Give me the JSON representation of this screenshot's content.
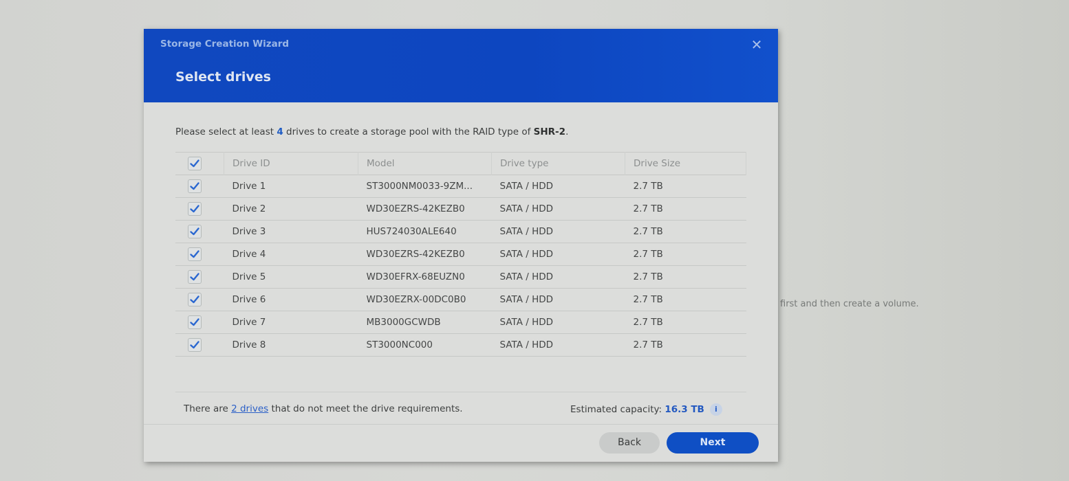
{
  "background": {
    "partial_text": "first and then create a volume."
  },
  "dialog": {
    "wizard_title": "Storage Creation Wizard",
    "step_title": "Select drives",
    "close_icon": "close-icon",
    "description": {
      "prefix": "Please select at least ",
      "min_drives": "4",
      "middle": " drives to create a storage pool with the RAID type of ",
      "raid_type": "SHR-2",
      "suffix": "."
    },
    "table": {
      "select_all_checked": true,
      "columns": [
        "Drive ID",
        "Model",
        "Drive type",
        "Drive Size"
      ],
      "rows": [
        {
          "checked": true,
          "drive_id": "Drive 1",
          "model": "ST3000NM0033-9ZM...",
          "type": "SATA / HDD",
          "size": "2.7 TB"
        },
        {
          "checked": true,
          "drive_id": "Drive 2",
          "model": "WD30EZRS-42KEZB0",
          "type": "SATA / HDD",
          "size": "2.7 TB"
        },
        {
          "checked": true,
          "drive_id": "Drive 3",
          "model": "HUS724030ALE640",
          "type": "SATA / HDD",
          "size": "2.7 TB"
        },
        {
          "checked": true,
          "drive_id": "Drive 4",
          "model": "WD30EZRS-42KEZB0",
          "type": "SATA / HDD",
          "size": "2.7 TB"
        },
        {
          "checked": true,
          "drive_id": "Drive 5",
          "model": "WD30EFRX-68EUZN0",
          "type": "SATA / HDD",
          "size": "2.7 TB"
        },
        {
          "checked": true,
          "drive_id": "Drive 6",
          "model": "WD30EZRX-00DC0B0",
          "type": "SATA / HDD",
          "size": "2.7 TB"
        },
        {
          "checked": true,
          "drive_id": "Drive 7",
          "model": "MB3000GCWDB",
          "type": "SATA / HDD",
          "size": "2.7 TB"
        },
        {
          "checked": true,
          "drive_id": "Drive 8",
          "model": "ST3000NC000",
          "type": "SATA / HDD",
          "size": "2.7 TB"
        }
      ]
    },
    "warning": {
      "prefix": "There are ",
      "link": "2 drives",
      "suffix": " that do not meet the drive requirements."
    },
    "capacity": {
      "label": "Estimated capacity: ",
      "value": "16.3 TB",
      "info_icon": "info-icon"
    },
    "buttons": {
      "back": "Back",
      "next": "Next"
    },
    "colors": {
      "header": "#0e49c2",
      "accent": "#1f5cc4",
      "next_button": "#0f4fc4"
    }
  }
}
